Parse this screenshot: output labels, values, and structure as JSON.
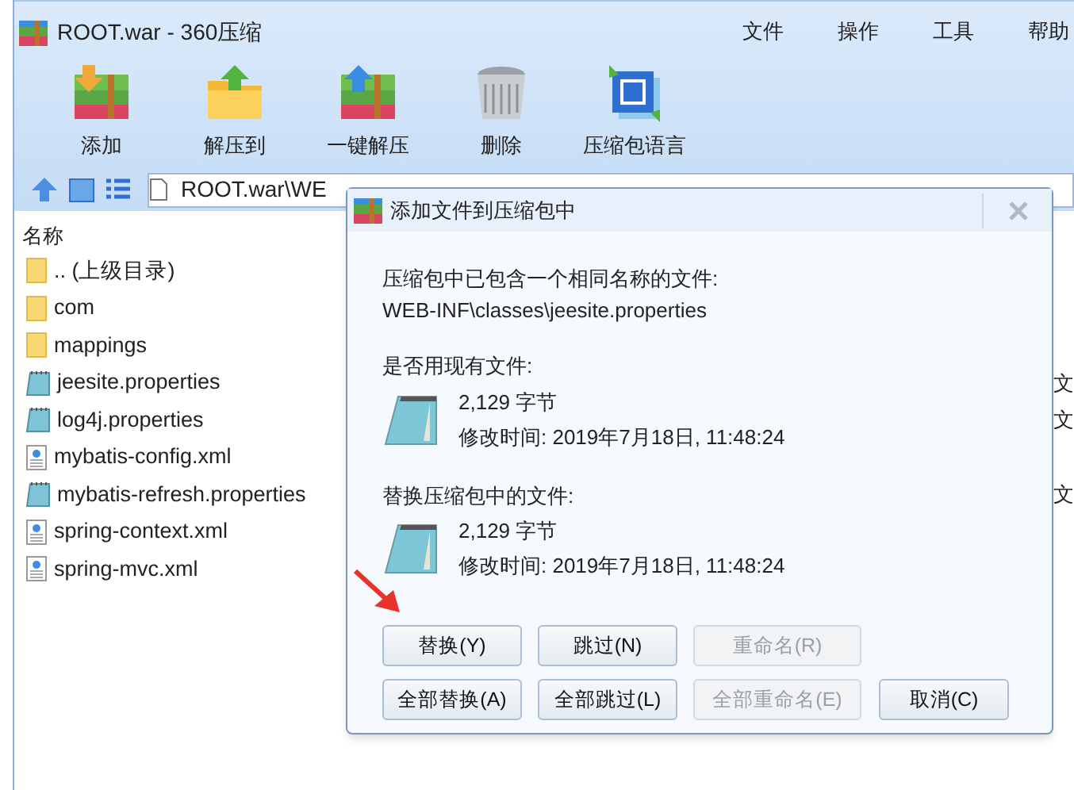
{
  "window": {
    "title": "ROOT.war - 360压缩"
  },
  "menu": [
    "文件",
    "操作",
    "工具",
    "帮助"
  ],
  "toolbar": [
    {
      "label": "添加",
      "kind": "add"
    },
    {
      "label": "解压到",
      "kind": "extract"
    },
    {
      "label": "一键解压",
      "kind": "quick"
    },
    {
      "label": "删除",
      "kind": "delete"
    },
    {
      "label": "压缩包语言",
      "kind": "language"
    }
  ],
  "address": "ROOT.war\\WE",
  "list": {
    "header": "名称",
    "files": [
      {
        "name": ".. (上级目录)",
        "kind": "folder"
      },
      {
        "name": "com",
        "kind": "folder"
      },
      {
        "name": "mappings",
        "kind": "folder"
      },
      {
        "name": "jeesite.properties",
        "kind": "text",
        "column_2": "文"
      },
      {
        "name": "log4j.properties",
        "kind": "text",
        "column_2": "文"
      },
      {
        "name": "mybatis-config.xml",
        "kind": "xml"
      },
      {
        "name": "mybatis-refresh.properties",
        "kind": "text",
        "column_2": "文"
      },
      {
        "name": "spring-context.xml",
        "kind": "xml"
      },
      {
        "name": "spring-mvc.xml",
        "kind": "xml"
      }
    ]
  },
  "dialog": {
    "title": "添加文件到压缩包中",
    "message": "压缩包中已包含一个相同名称的文件:",
    "path": "WEB-INF\\classes\\jeesite.properties",
    "files": [
      {
        "heading": "是否用现有文件:",
        "size": "2,129 字节",
        "modified": "修改时间: 2019年7月18日, 11:48:24"
      },
      {
        "heading": "替换压缩包中的文件:",
        "size": "2,129 字节",
        "modified": "修改时间: 2019年7月18日, 11:48:24"
      }
    ],
    "button_rows": [
      [
        {
          "label": "替换(Y)",
          "disabled": false
        },
        {
          "label": "跳过(N)",
          "disabled": false
        },
        {
          "label": "重命名(R)",
          "disabled": true
        }
      ],
      [
        {
          "label": "全部替换(A)",
          "disabled": false
        },
        {
          "label": "全部跳过(L)",
          "disabled": false
        },
        {
          "label": "全部重命名(E)",
          "disabled": true
        },
        {
          "label": "取消(C)",
          "disabled": false
        }
      ]
    ]
  }
}
